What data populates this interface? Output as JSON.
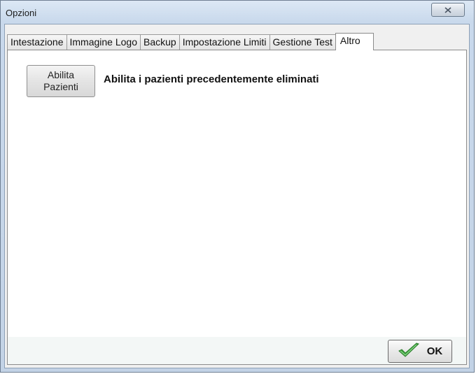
{
  "window": {
    "title": "Opzioni"
  },
  "tabs": [
    {
      "label": "Intestazione",
      "active": false
    },
    {
      "label": "Immagine Logo",
      "active": false
    },
    {
      "label": "Backup",
      "active": false
    },
    {
      "label": "Impostazione Limiti",
      "active": false
    },
    {
      "label": "Gestione Test",
      "active": false
    },
    {
      "label": "Altro",
      "active": true
    }
  ],
  "altro": {
    "enable_button_line1": "Abilita",
    "enable_button_line2": "Pazienti",
    "description": "Abilita i pazienti precedentemente eliminati"
  },
  "footer": {
    "ok_label": "OK",
    "ok_icon": "checkmark-icon"
  },
  "colors": {
    "checkmark": "#3da43d"
  }
}
